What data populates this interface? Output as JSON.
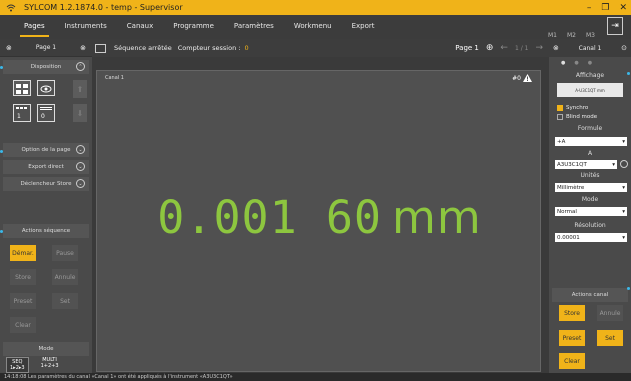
{
  "app": {
    "title": "SYLCOM 1.2.1874.0 - temp - Supervisor",
    "window_controls": [
      "–",
      "❐",
      "✕"
    ]
  },
  "menu": {
    "items": [
      "Pages",
      "Instruments",
      "Canaux",
      "Programme",
      "Paramètres",
      "Workmenu",
      "Export"
    ],
    "memory_tabs": [
      "M1",
      "M2",
      "M3"
    ]
  },
  "left_panel": {
    "header": "Page 1",
    "sections": {
      "disposition": "Disposition",
      "page_options": "Option de la page",
      "direct_export": "Export direct",
      "store_trigger": "Déclencheur Store",
      "sequence_actions": "Actions séquence",
      "mode": "Mode"
    },
    "layout_fields": [
      "1",
      "0"
    ],
    "sequence_buttons": [
      "Démar.",
      "Pause",
      "Store",
      "Annule",
      "Preset",
      "Set",
      "Clear"
    ],
    "modes": [
      {
        "label": "SEQ",
        "sub": "1▸2▸3"
      },
      {
        "label": "MULTI",
        "sub": "1+2+3"
      }
    ]
  },
  "toolbar": {
    "status": "Séquence arrêtée",
    "counter_label": "Compteur session :",
    "counter_value": "0",
    "page": "Page 1",
    "page_nav": "1 / 1"
  },
  "canvas": {
    "channel": "Canal 1",
    "warning_count": "#0",
    "value": "0.001 60",
    "unit": "mm"
  },
  "right_panel": {
    "header": "Canal 1",
    "display_label": "Affichage",
    "display_preview": "A-U3C1QT mm",
    "synchro": "Synchro",
    "blind_mode": "Blind mode",
    "formula_label": "Formule",
    "formula_value": "+A",
    "a_label": "A",
    "a_value": "A3U3C1QT",
    "units_label": "Unités",
    "units_value": "Millimètre",
    "mode_label": "Mode",
    "mode_value": "Normal",
    "resolution_label": "Résolution",
    "resolution_value": "0.00001",
    "actions_label": "Actions canal",
    "action_buttons": [
      "Store",
      "Annule",
      "Preset",
      "Set",
      "Clear"
    ]
  },
  "status_bar": {
    "message": "14:18:08 Les paramètres du canal «Canal 1» ont été appliqués à l'instrument «A3U3C1QT»"
  },
  "colors": {
    "accent": "#f0b319",
    "value": "#8dc63f",
    "highlight": "#3bb7e8"
  }
}
